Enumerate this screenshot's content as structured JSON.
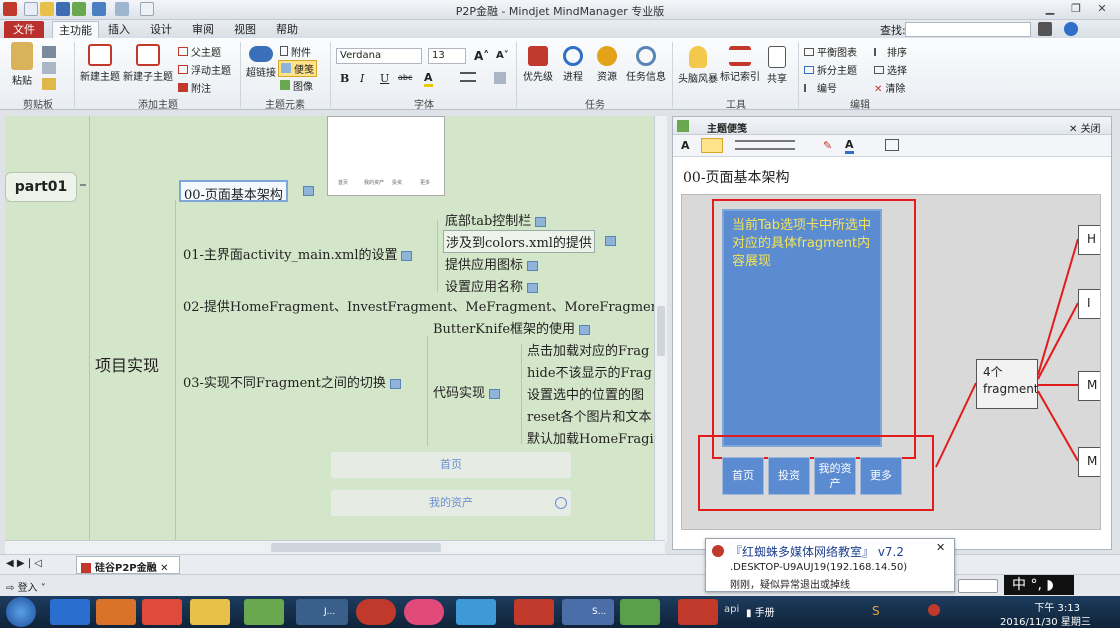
{
  "window": {
    "title": "P2P金融 - Mindjet MindManager 专业版"
  },
  "menu_tabs": [
    "文件",
    "主功能",
    "插入",
    "设计",
    "审阅",
    "视图",
    "帮助"
  ],
  "search": {
    "label": "查找:",
    "value": ""
  },
  "ribbon": {
    "clipboard": {
      "paste": "粘贴",
      "group": "剪贴板"
    },
    "add_topic": {
      "new_topic": "新建主题",
      "new_subtopic": "新建子主题",
      "parent_topic": "父主题",
      "floating_topic": "浮动主题",
      "callout": "附注",
      "group": "添加主题"
    },
    "topic_elements": {
      "hyperlink": "超链接",
      "attachment": "附件",
      "notes": "便笺",
      "image": "图像",
      "group": "主题元素"
    },
    "font": {
      "family": "Verdana",
      "size": "13",
      "bold": "B",
      "italic": "I",
      "underline": "U",
      "strike": "abc",
      "group": "字体"
    },
    "task": {
      "priority": "优先级",
      "progress": "进程",
      "resource": "资源",
      "task_info": "任务信息",
      "group": "任务"
    },
    "tools": {
      "brainstorm": "头脑风暴",
      "markers": "标记索引",
      "share": "共享",
      "group": "工具"
    },
    "edit": {
      "balance": "平衡图表",
      "split": "拆分主题",
      "numbering": "编号",
      "sort": "排序",
      "select": "选择",
      "clear": "清除",
      "group": "编辑"
    }
  },
  "map": {
    "main_topic": "part01",
    "central": "项目实现",
    "t00": "00-页面基本架构",
    "t01": "01-主界面activity_main.xml的设置",
    "t01_children": [
      "底部tab控制栏",
      "涉及到colors.xml的提供",
      "提供应用图标",
      "设置应用名称"
    ],
    "t02": "02-提供HomeFragment、InvestFragment、MeFragment、MoreFragmen",
    "t03": "03-实现不同Fragment之间的切换",
    "t03_child_top": "ButterKnife框架的使用",
    "t03_code": "代码实现",
    "t03_code_children": [
      "点击加载对应的Frag",
      "hide不该显示的Frag",
      "设置选中的位置的图",
      "reset各个图片和文本",
      "默认加载HomeFragi"
    ],
    "thumb_labels": [
      "首页",
      "我的资产",
      "投资",
      "更多"
    ],
    "bottom_items": [
      "首页",
      "我的资产"
    ]
  },
  "notes_panel": {
    "title": "主题便笺",
    "close": "关闭",
    "topic": "00-页面基本架构",
    "diagram": {
      "content_text": "当前Tab选项卡中所选中对应的具体fragment内容展现",
      "tabs": [
        "首页",
        "投资",
        "我的资产",
        "更多"
      ],
      "fragment_box": "4个 fragment",
      "side_letters": [
        "H",
        "I",
        "M",
        "M"
      ]
    }
  },
  "doc_tab": {
    "label": "硅谷P2P金融"
  },
  "status": {
    "login": "登入"
  },
  "popup": {
    "title": "『红蜘蛛多媒体网络教室』 v7.2",
    "line1": ".DESKTOP-U9AUJ19(192.168.14.50)",
    "line2": "刚刚，疑似异常退出或掉线"
  },
  "taskbar": {
    "items": [
      "J...",
      "S..."
    ],
    "tray_label": "api",
    "tray_folder": "手册",
    "ime": "中",
    "time": "下午 3:13",
    "date": "2016/11/30 星期三"
  }
}
